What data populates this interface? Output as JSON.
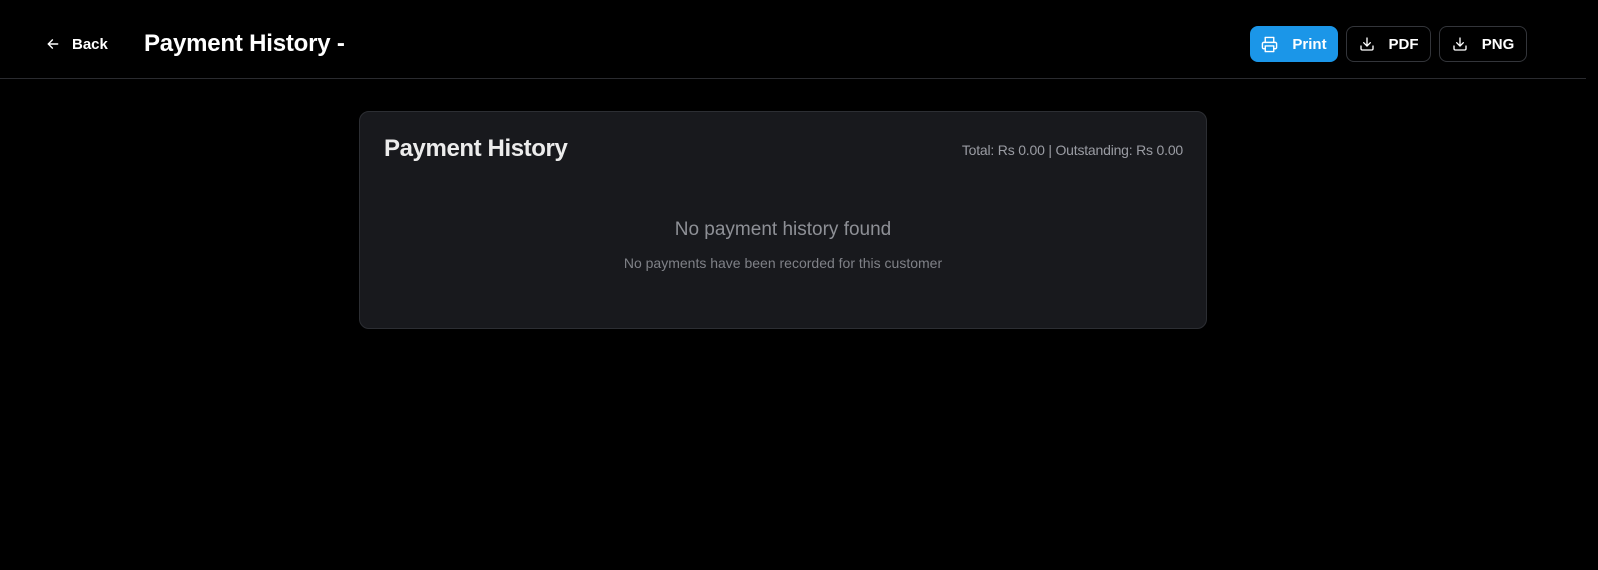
{
  "header": {
    "back_label": "Back",
    "title": "Payment History -",
    "actions": {
      "print_label": "Print",
      "pdf_label": "PDF",
      "png_label": "PNG"
    },
    "icons": {
      "back": "arrow-left-icon",
      "print": "printer-icon",
      "pdf": "download-icon",
      "png": "download-icon"
    }
  },
  "card": {
    "title": "Payment History",
    "summary": "Total: Rs 0.00 | Outstanding: Rs 0.00",
    "empty_title": "No payment history found",
    "empty_subtitle": "No payments have been recorded for this customer"
  },
  "colors": {
    "background": "#000000",
    "accent": "#1b96e8",
    "card_background": "#18191d"
  }
}
